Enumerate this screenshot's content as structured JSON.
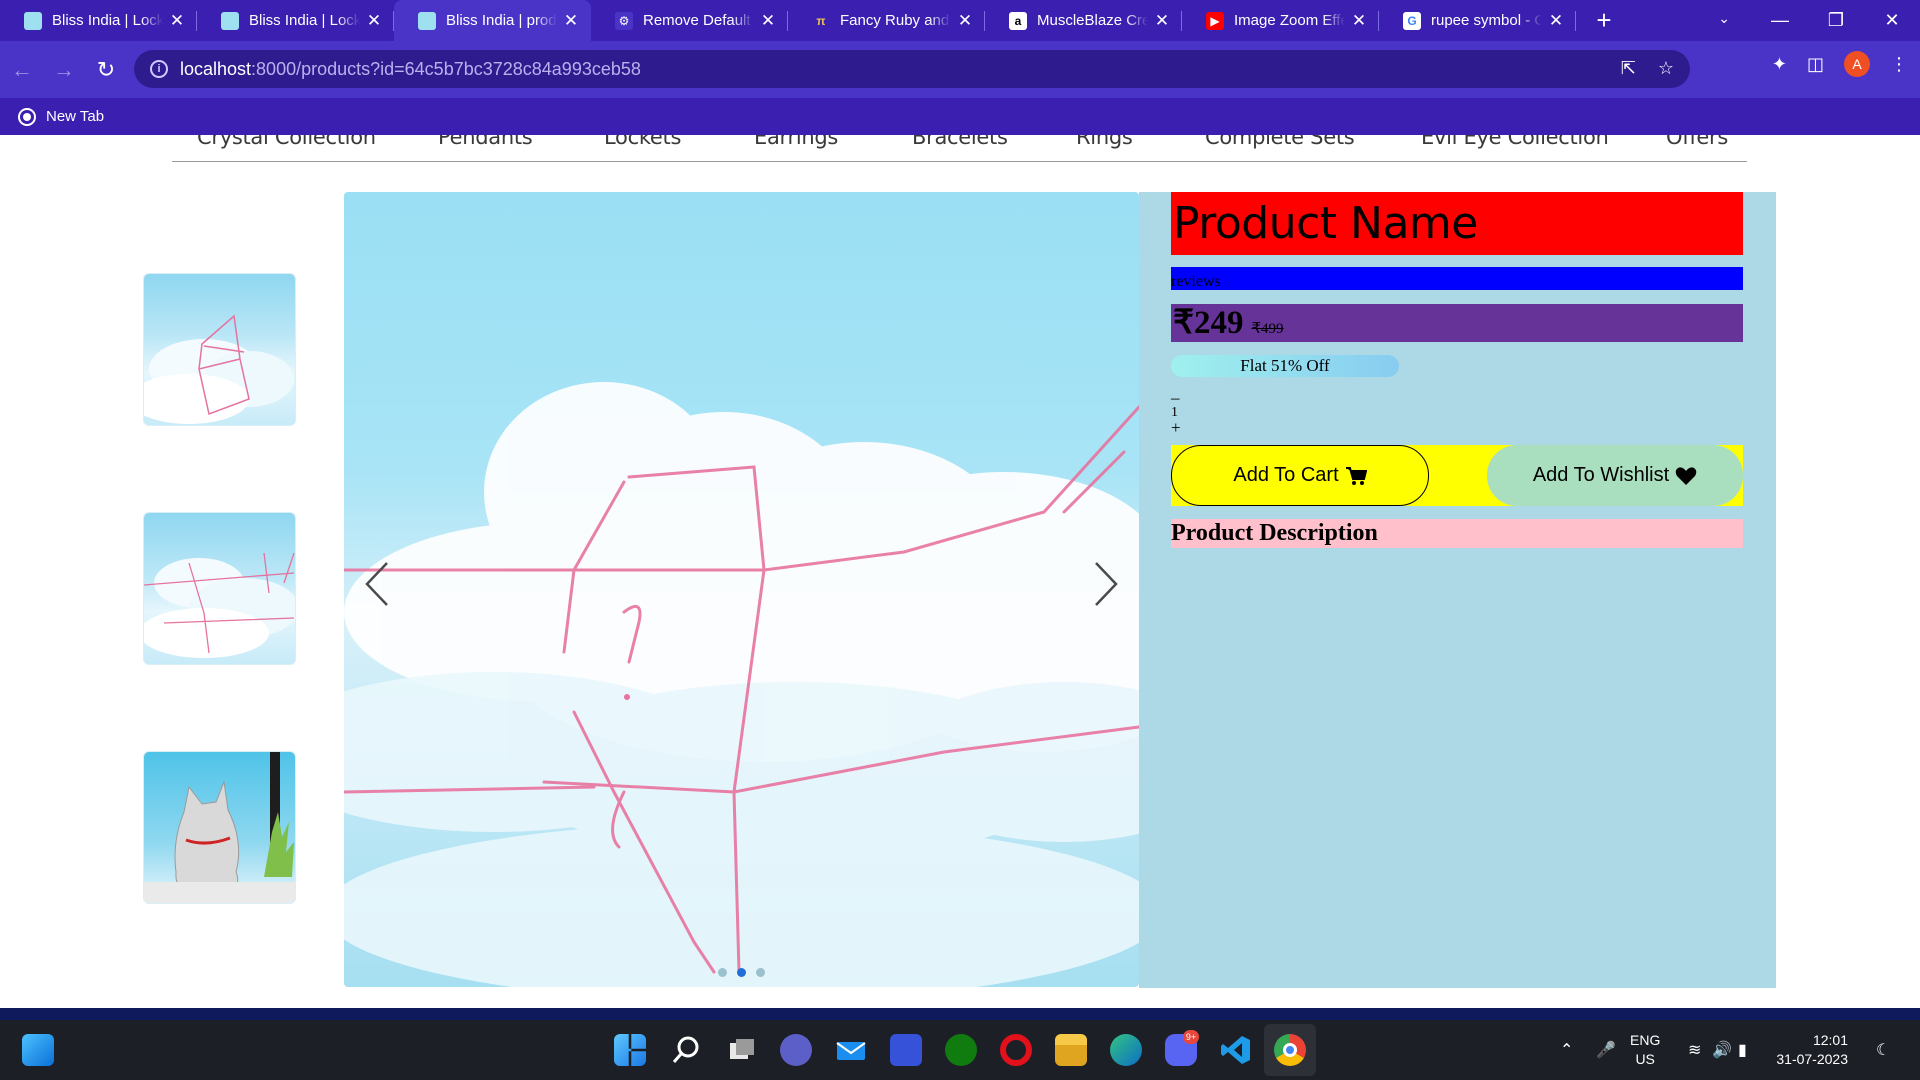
{
  "browser": {
    "tabs": [
      {
        "title": "Bliss India | Lockets",
        "favicon": "bliss-favicon",
        "active": false
      },
      {
        "title": "Bliss India | Lockets",
        "favicon": "bliss-favicon",
        "active": false
      },
      {
        "title": "Bliss India | products",
        "favicon": "bliss-favicon",
        "active": true
      },
      {
        "title": "Remove Default Ch",
        "favicon": "chatgpt-favicon",
        "active": false
      },
      {
        "title": "Fancy Ruby and D",
        "favicon": "pi-favicon",
        "active": false
      },
      {
        "title": "MuscleBlaze Crea",
        "favicon": "amazon-favicon",
        "active": false
      },
      {
        "title": "Image Zoom Effec",
        "favicon": "youtube-favicon",
        "active": false
      },
      {
        "title": "rupee symbol - Go",
        "favicon": "google-favicon",
        "active": false
      }
    ],
    "url_host": "localhost",
    "url_path": ":8000/products?id=64c5b7bc3728c84a993ceb58",
    "profile_initial": "A",
    "bookmarks": [
      {
        "label": "New Tab"
      }
    ]
  },
  "nav": {
    "categories": [
      "Crystal Collection",
      "Pendants",
      "Lockets",
      "Earrings",
      "Bracelets",
      "Rings",
      "Complete Sets",
      "Evil Eye Collection",
      "Offers"
    ]
  },
  "product": {
    "name": "Product Name",
    "reviews": "reviews",
    "price": "₹249",
    "mrp": "₹499",
    "discount": "Flat 51% Off",
    "qty_minus": "–",
    "qty_value": "1",
    "qty_plus": "+",
    "add_to_cart": "Add To Cart",
    "add_to_wishlist": "Add To Wishlist",
    "description_heading": "Product Description"
  },
  "gallery": {
    "thumbnails": [
      "thumbnail-1",
      "thumbnail-2",
      "thumbnail-3"
    ],
    "active_slide": 2,
    "slide_count": 3
  },
  "taskbar": {
    "lang_1": "ENG",
    "lang_2": "US",
    "time": "12:01",
    "date": "31-07-2023",
    "discord_badge": "9+"
  },
  "colors": {
    "tabstrip": "#3a1fb0",
    "toolbar": "#4a34c8",
    "details_bg": "#add8e6",
    "name_bg": "#ff0000",
    "reviews_bg": "#0000ff",
    "price_bg": "#663399",
    "buttons_bg": "#ffff00",
    "wishlist_bg": "#a9dfbf",
    "description_bg": "#ffc0cb"
  }
}
